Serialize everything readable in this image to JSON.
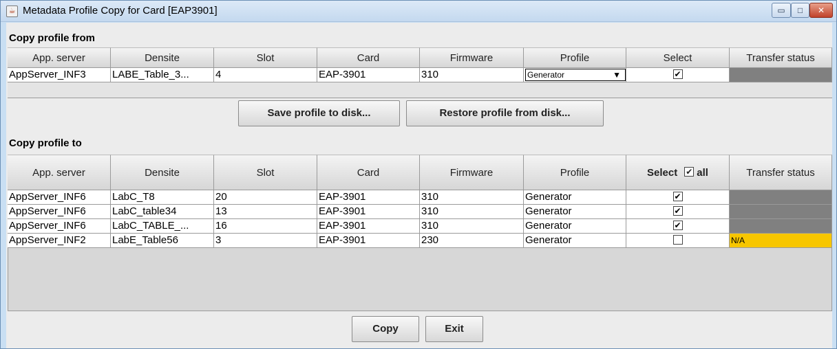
{
  "window": {
    "title": "Metadata Profile Copy for Card [EAP3901]",
    "minimize_glyph": "▭",
    "maximize_glyph": "□",
    "close_glyph": "✕",
    "app_icon_glyph": "☕"
  },
  "from_section": {
    "label": "Copy profile from",
    "headers": [
      "App. server",
      "Densite",
      "Slot",
      "Card",
      "Firmware",
      "Profile",
      "Select",
      "Transfer status"
    ],
    "row": {
      "app_server": "AppServer_INF3",
      "densite": "LABE_Table_3...",
      "slot": "4",
      "card": "EAP-3901",
      "firmware": "310",
      "profile": "Generator",
      "selected": true,
      "transfer_status": ""
    }
  },
  "disk_buttons": {
    "save": "Save profile to disk...",
    "restore": "Restore profile from disk..."
  },
  "to_section": {
    "label": "Copy profile to",
    "headers": [
      "App. server",
      "Densite",
      "Slot",
      "Card",
      "Firmware",
      "Profile",
      "Select",
      "all",
      "Transfer status"
    ],
    "select_all_checked": true,
    "rows": [
      {
        "app_server": "AppServer_INF6",
        "densite": "LabC_T8",
        "slot": "20",
        "card": "EAP-3901",
        "firmware": "310",
        "profile": "Generator",
        "selected": true,
        "transfer_status": ""
      },
      {
        "app_server": "AppServer_INF6",
        "densite": "LabC_table34",
        "slot": "13",
        "card": "EAP-3901",
        "firmware": "310",
        "profile": "Generator",
        "selected": true,
        "transfer_status": ""
      },
      {
        "app_server": "AppServer_INF6",
        "densite": "LabC_TABLE_...",
        "slot": "16",
        "card": "EAP-3901",
        "firmware": "310",
        "profile": "Generator",
        "selected": true,
        "transfer_status": ""
      },
      {
        "app_server": "AppServer_INF2",
        "densite": "LabE_Table56",
        "slot": "3",
        "card": "EAP-3901",
        "firmware": "230",
        "profile": "Generator",
        "selected": false,
        "transfer_status": "N/A"
      }
    ]
  },
  "footer_buttons": {
    "copy": "Copy",
    "exit": "Exit"
  },
  "colors": {
    "status_gray": "#808080",
    "status_na": "#f7c600"
  }
}
